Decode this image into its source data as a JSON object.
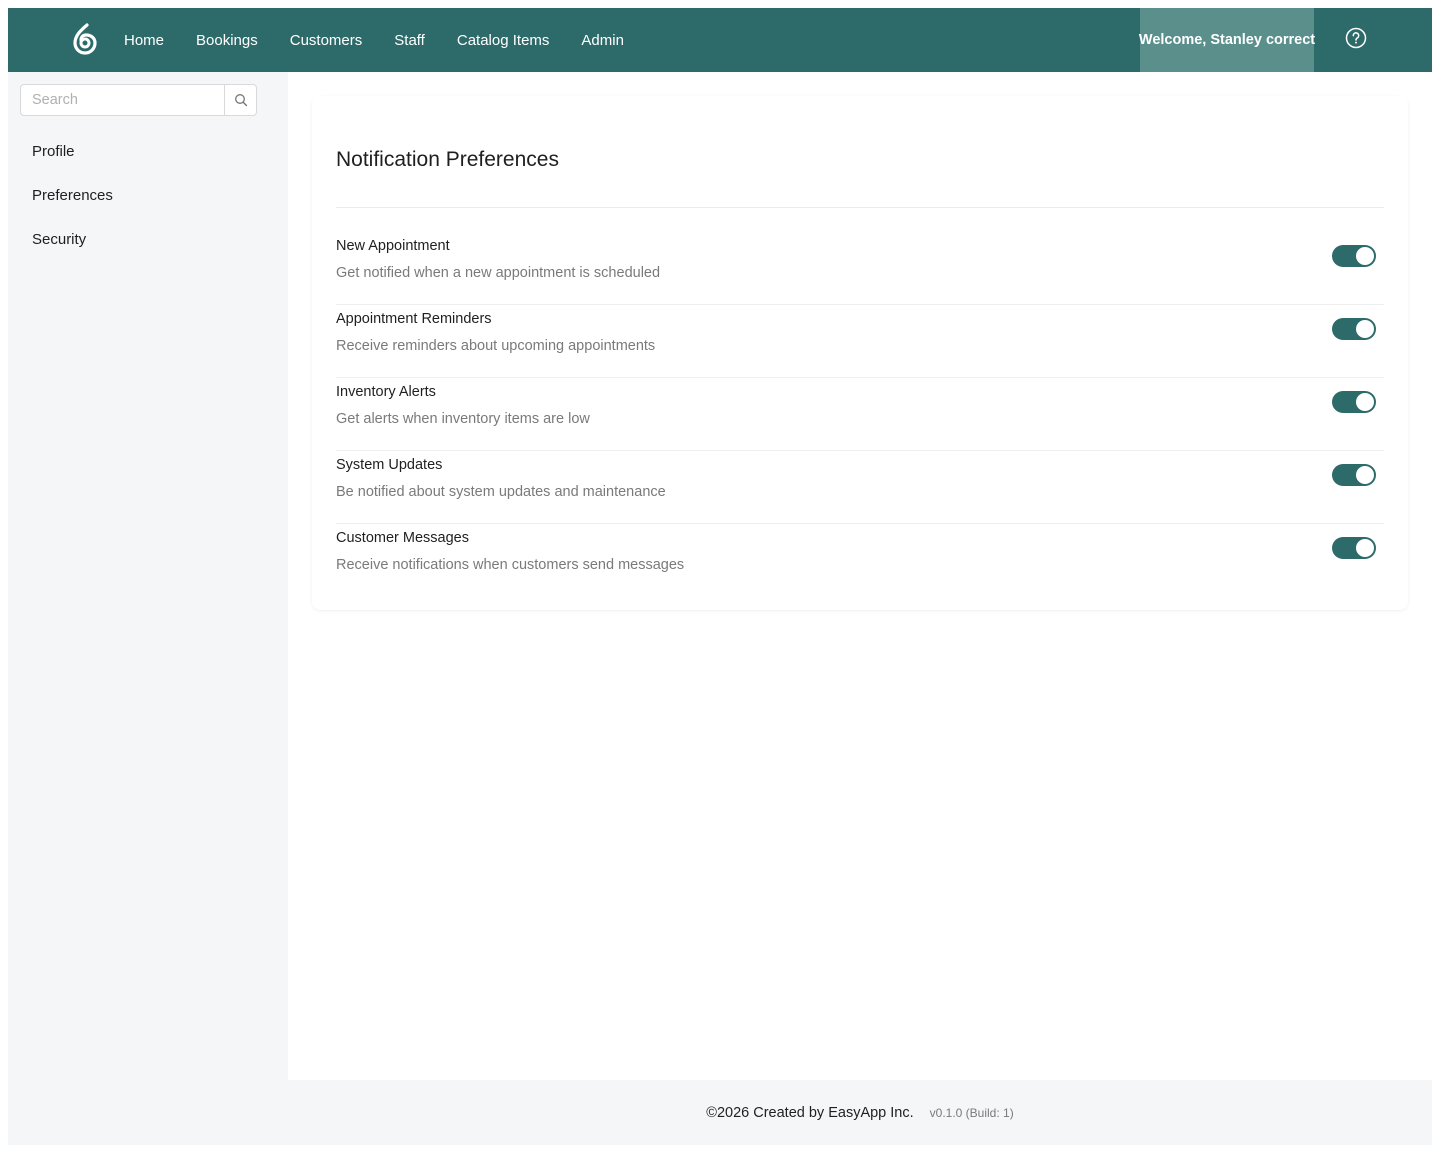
{
  "header": {
    "nav": [
      "Home",
      "Bookings",
      "Customers",
      "Staff",
      "Catalog Items",
      "Admin"
    ],
    "welcome": "Welcome, Stanley correct",
    "logo_icon": "flame-logo-icon",
    "help_icon": "question-circle-icon",
    "bg_color": "#2d6b6a"
  },
  "sidebar": {
    "search_placeholder": "Search",
    "search_icon": "search-icon",
    "items": [
      "Profile",
      "Preferences",
      "Security"
    ]
  },
  "main": {
    "title": "Notification Preferences",
    "preferences": [
      {
        "title": "New Appointment",
        "description": "Get notified when a new appointment is scheduled",
        "enabled": true
      },
      {
        "title": "Appointment Reminders",
        "description": "Receive reminders about upcoming appointments",
        "enabled": true
      },
      {
        "title": "Inventory Alerts",
        "description": "Get alerts when inventory items are low",
        "enabled": true
      },
      {
        "title": "System Updates",
        "description": "Be notified about system updates and maintenance",
        "enabled": true
      },
      {
        "title": "Customer Messages",
        "description": "Receive notifications when customers send messages",
        "enabled": true
      }
    ],
    "toggle_color": "#2d6b6a"
  },
  "footer": {
    "copyright": "©2026 Created by EasyApp Inc.",
    "version": "v0.1.0 (Build: 1)"
  }
}
